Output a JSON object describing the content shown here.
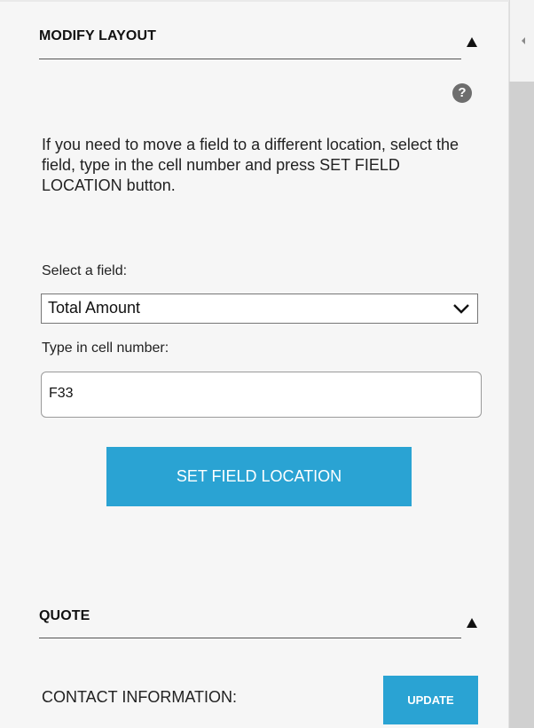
{
  "modify_layout": {
    "title": "MODIFY LAYOUT",
    "help_icon": "help-icon",
    "help_glyph": "?",
    "instructions": "If you need to move a field to a different location, select the field, type in the cell number and press SET FIELD LOCATION button.",
    "select_label": "Select a field:",
    "selected_field": "Total Amount",
    "cell_label": "Type in cell number:",
    "cell_value": "F33",
    "set_button_label": "SET FIELD LOCATION"
  },
  "quote": {
    "title": "QUOTE",
    "contact_label": "CONTACT INFORMATION:",
    "update_button_label": "UPDATE"
  },
  "colors": {
    "accent": "#2aa3d3",
    "panel_background": "#f6f6f6",
    "scrollbar_track": "#d0d0d0"
  }
}
